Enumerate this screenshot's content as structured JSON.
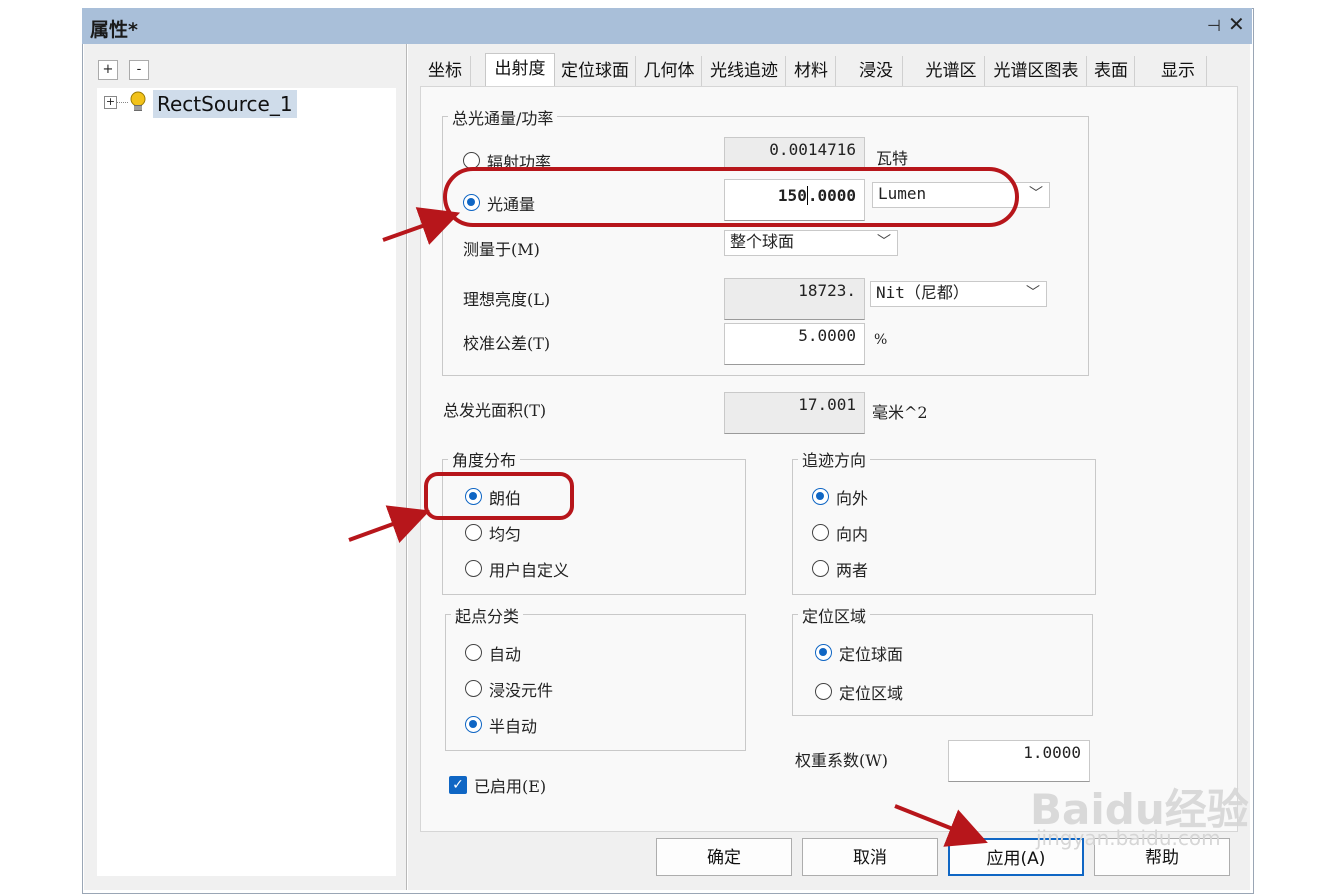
{
  "window": {
    "title": "属性*",
    "pin_glyph": "⊣",
    "close_glyph": "✕"
  },
  "tree": {
    "expand_btn": "+",
    "collapse_btn": "-",
    "root_label": "RectSource_1"
  },
  "tabs": [
    "坐标",
    "出射度",
    "定位球面",
    "几何体",
    "光线追迹",
    "材料",
    "浸没",
    "光谱区",
    "光谱区图表",
    "表面",
    "显示"
  ],
  "total_flux": {
    "legend": "总光通量/功率",
    "radiant_power": {
      "label": "辐射功率",
      "value": "0.0014716",
      "unit": "瓦特"
    },
    "luminous_flux": {
      "label": "光通量",
      "value_int": "150",
      "value_frac": ".0000",
      "unit_option": "Lumen"
    },
    "measured_at": {
      "label": "测量于(M)",
      "option": "整个球面"
    },
    "ideal_luminance": {
      "label": "理想亮度(L)",
      "value": "18723.",
      "unit_option": "Nit（尼都）"
    },
    "calibration_tol": {
      "label": "校准公差(T)",
      "value": "5.0000",
      "unit": "%"
    }
  },
  "emitting_area": {
    "label": "总发光面积(T)",
    "value": "17.001",
    "unit": "毫米^2"
  },
  "angular_dist": {
    "legend": "角度分布",
    "options": [
      "朗伯",
      "均匀",
      "用户自定义"
    ],
    "selected": 0
  },
  "trace_dir": {
    "legend": "追迹方向",
    "options": [
      "向外",
      "向内",
      "两者"
    ],
    "selected": 0
  },
  "origin_class": {
    "legend": "起点分类",
    "options": [
      "自动",
      "浸没元件",
      "半自动"
    ],
    "selected": 2
  },
  "location_region": {
    "legend": "定位区域",
    "options": [
      "定位球面",
      "定位区域"
    ],
    "selected": 0
  },
  "weight": {
    "label": "权重系数(W)",
    "value": "1.0000"
  },
  "enabled": {
    "label": "已启用(E)",
    "checked": true
  },
  "buttons": {
    "ok": "确定",
    "cancel": "取消",
    "apply": "应用(A)",
    "help": "帮助"
  },
  "watermark": {
    "brand": "Baidu经验",
    "url": "jingyan.baidu.com"
  },
  "colors": {
    "accent": "#0f66c4",
    "annotation_red": "#b7161b",
    "titlebar": "#a9bfd9"
  }
}
